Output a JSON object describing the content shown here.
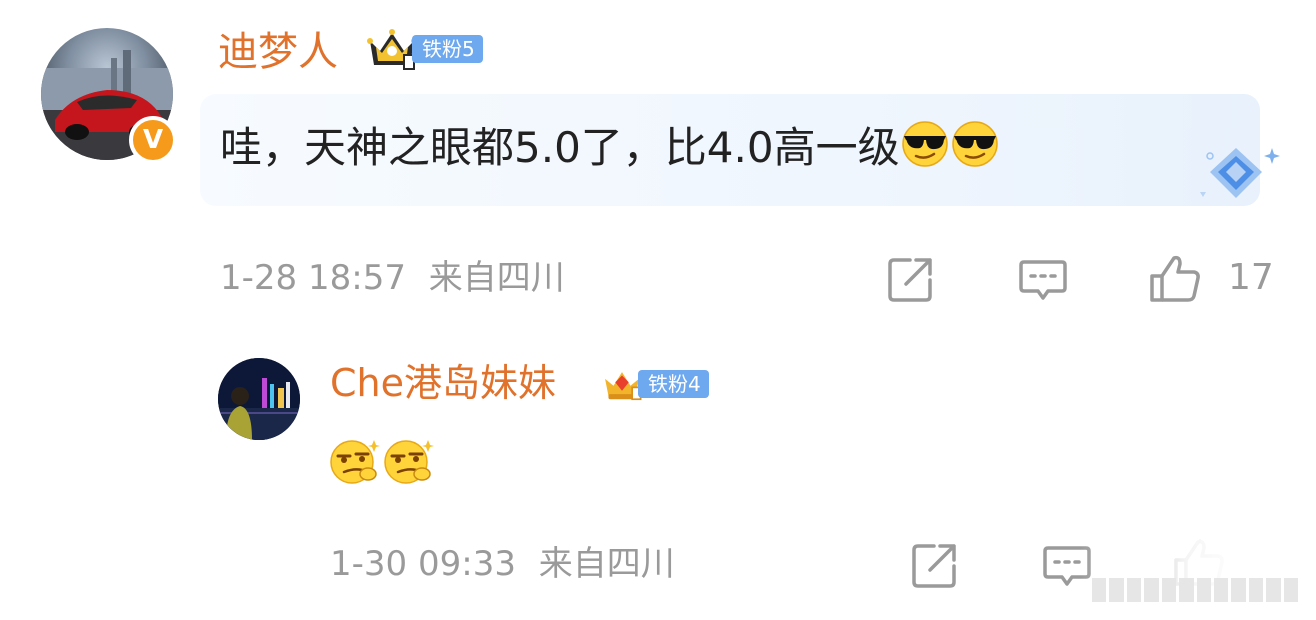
{
  "main_comment": {
    "username": "迪梦人",
    "fan_level": "铁粉5",
    "verified_badge": "V",
    "text": "哇，天神之眼都5.0了，比4.0高一级",
    "emoji_names": [
      "cool-sunglasses-emoji",
      "cool-sunglasses-emoji"
    ],
    "timestamp": "1-28 18:57",
    "location": "来自四川",
    "like_count": "17"
  },
  "reply": {
    "username": "Che港岛妹妹",
    "fan_level": "铁粉4",
    "emoji_names": [
      "smirk-emoji",
      "smirk-emoji"
    ],
    "timestamp": "1-30 09:33",
    "location": "来自四川",
    "like_count": "1"
  },
  "colors": {
    "username": "#e0722c",
    "fan_tag": "#6ea8ee",
    "meta_gray": "#9a9a9a",
    "text": "#222222",
    "verified": "#f59a1a"
  },
  "icons": [
    "share-icon",
    "comment-icon",
    "thumbs-up-icon"
  ]
}
